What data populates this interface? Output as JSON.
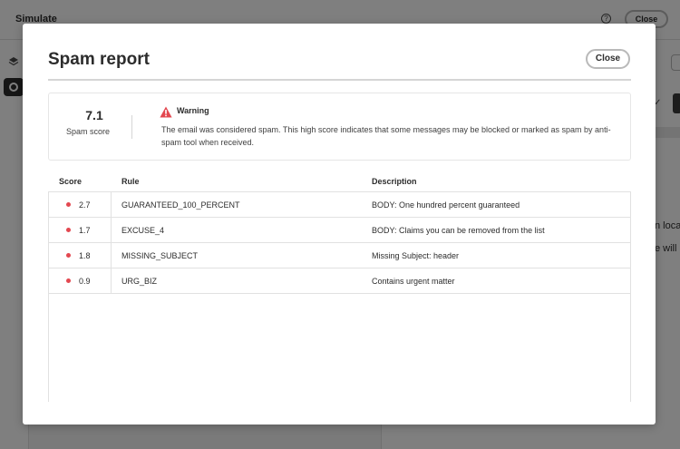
{
  "background": {
    "app_title": "Simulate",
    "close_label": "Close",
    "help_glyph": "?",
    "partial_text_1": "n loca",
    "partial_text_2": "e will"
  },
  "modal": {
    "title": "Spam report",
    "close_label": "Close",
    "score": {
      "value": "7.1",
      "label": "Spam score"
    },
    "warning": {
      "title": "Warning",
      "message": "The email was considered spam. This high score indicates that some messages may be blocked or marked as spam by anti-spam tool when received."
    },
    "table": {
      "headers": {
        "score": "Score",
        "rule": "Rule",
        "description": "Description"
      },
      "rows": [
        {
          "score": "2.7",
          "rule": "GUARANTEED_100_PERCENT",
          "description": "BODY: One hundred percent guaranteed"
        },
        {
          "score": "1.7",
          "rule": "EXCUSE_4",
          "description": "BODY: Claims you can be removed from the list"
        },
        {
          "score": "1.8",
          "rule": "MISSING_SUBJECT",
          "description": "Missing Subject: header"
        },
        {
          "score": "0.9",
          "rule": "URG_BIZ",
          "description": "Contains urgent matter"
        }
      ]
    }
  },
  "colors": {
    "accent_red": "#e34850",
    "text_dark": "#2c2c2c",
    "border": "#e1e1e1"
  },
  "icons": {
    "warning": "warning-triangle-icon",
    "rule_status": "status-dot-icon",
    "help": "help-circle-icon",
    "layers": "layers-icon",
    "target": "target-icon"
  }
}
